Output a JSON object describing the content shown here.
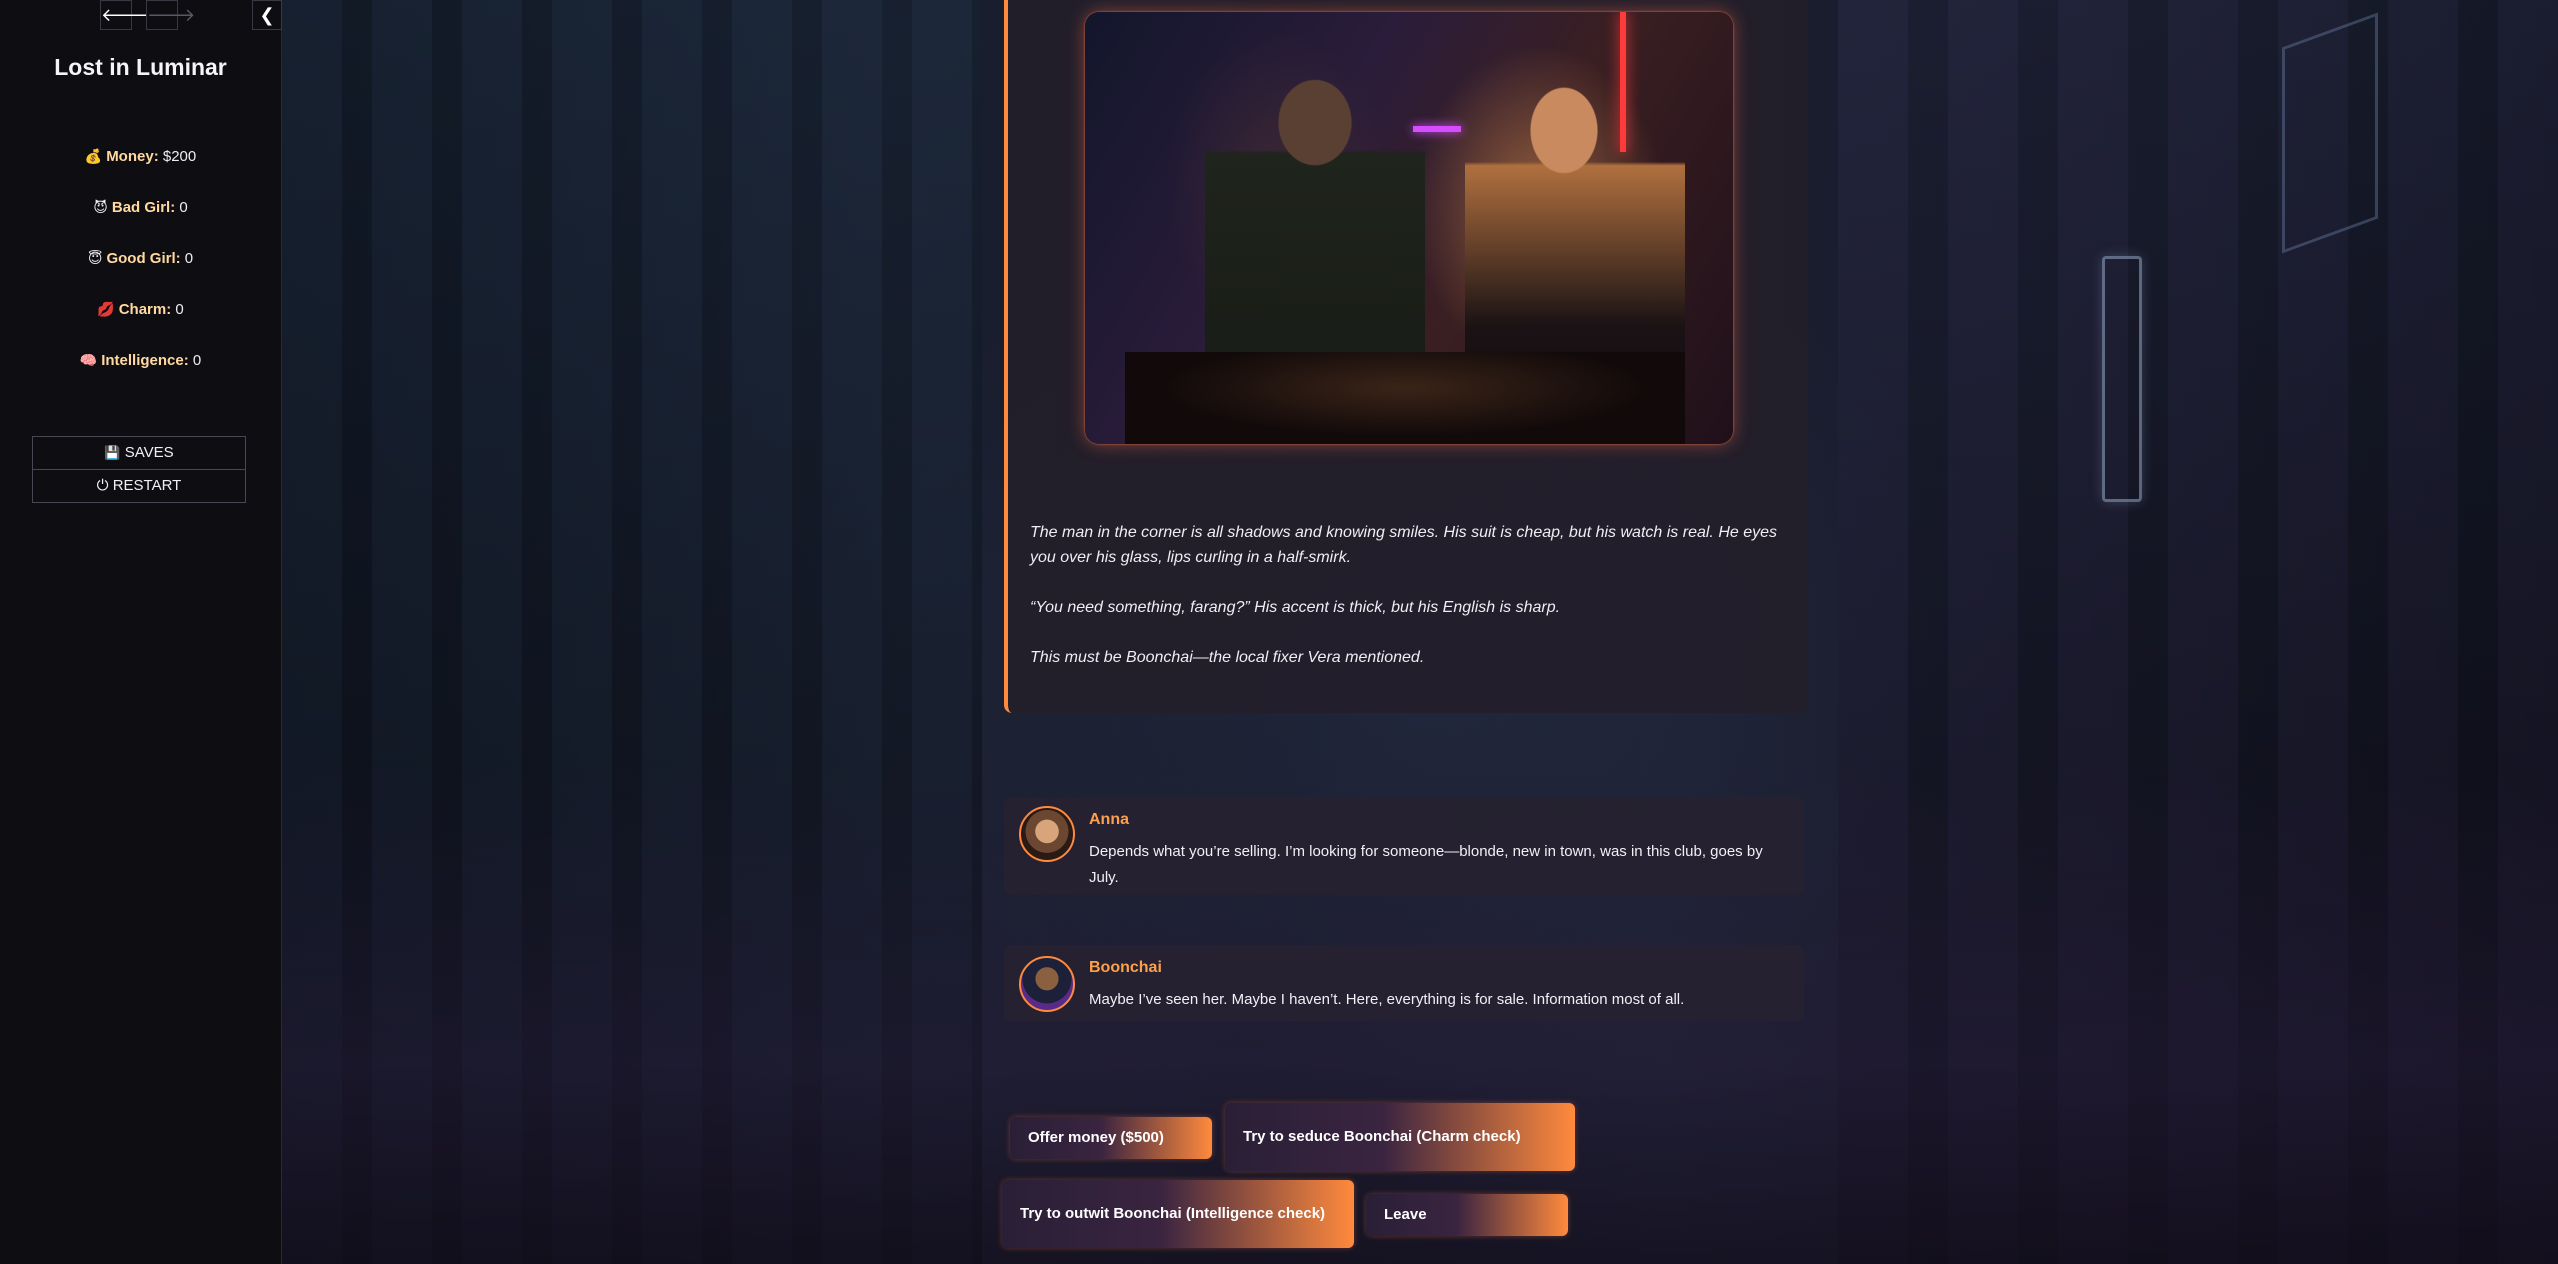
{
  "sidebar": {
    "back_icon": "🡐",
    "forward_icon": "🡒",
    "collapse_icon": "❮",
    "title": "Lost in Luminar",
    "stats": [
      {
        "icon": "💰",
        "label": "Money:",
        "value": "$200"
      },
      {
        "icon": "😈",
        "label": "Bad Girl:",
        "value": "0"
      },
      {
        "icon": "😇",
        "label": "Good Girl:",
        "value": "0"
      },
      {
        "icon": "💋",
        "label": "Charm:",
        "value": "0"
      },
      {
        "icon": "🧠",
        "label": "Intelligence:",
        "value": "0"
      }
    ],
    "saves_icon": "💾",
    "saves_label": "SAVES",
    "restart_icon": "⏻",
    "restart_label": "RESTART"
  },
  "story": {
    "paragraphs": [
      "The man in the corner is all shadows and knowing smiles. His suit is cheap, but his watch is real. He eyes you over his glass, lips curling in a half-smirk.",
      "“You need something, farang?” His accent is thick, but his English is sharp.",
      "This must be Boonchai—the local fixer Vera mentioned."
    ]
  },
  "chat": [
    {
      "speaker": "Anna",
      "text": "Depends what you’re selling. I’m looking for someone—blonde, new in town, was in this club, goes by July."
    },
    {
      "speaker": "Boonchai",
      "text": "Maybe I’ve seen her. Maybe I haven’t. Here, everything is for sale. Information most of all."
    }
  ],
  "choices": [
    "Offer money ($500)",
    "Try to seduce Boonchai (Charm check)",
    "Try to outwit Boonchai (Intelligence check)",
    "Leave"
  ],
  "colors": {
    "accent": "#ff8a3d",
    "speaker": "#ff9f4a",
    "sidebar_bg": "#0e0d12"
  }
}
